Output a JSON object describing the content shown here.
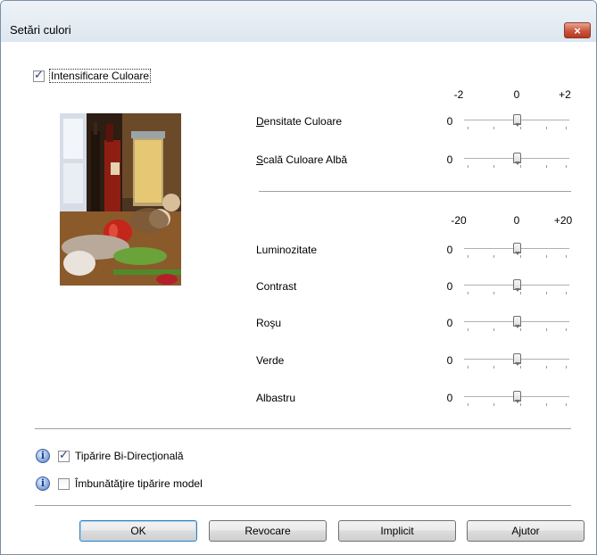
{
  "window": {
    "title": "Setări culori",
    "close_label": "×"
  },
  "color_enhance": {
    "label": "Intensificare Culoare",
    "checked": true
  },
  "scale_top": {
    "min": "-2",
    "mid": "0",
    "max": "+2"
  },
  "scale_bottom": {
    "min": "-20",
    "mid": "0",
    "max": "+20"
  },
  "settings_top": [
    {
      "label": "Densitate Culoare",
      "value": "0"
    },
    {
      "label": "Scală Culoare Albă",
      "value": "0"
    }
  ],
  "settings_bottom": [
    {
      "label": "Luminozitate",
      "value": "0"
    },
    {
      "label": "Contrast",
      "value": "0"
    },
    {
      "label": "Roşu",
      "value": "0"
    },
    {
      "label": "Verde",
      "value": "0"
    },
    {
      "label": "Albastru",
      "value": "0"
    }
  ],
  "options": [
    {
      "label": "Tipărire Bi-Direcţională",
      "checked": true
    },
    {
      "label": "Îmbunătăţire tipărire model",
      "checked": false
    }
  ],
  "buttons": {
    "ok": "OK",
    "cancel": "Revocare",
    "default": "Implicit",
    "help": "Ajutor"
  },
  "icons": {
    "info": "info-icon",
    "close": "close-icon",
    "check": "check-icon"
  }
}
